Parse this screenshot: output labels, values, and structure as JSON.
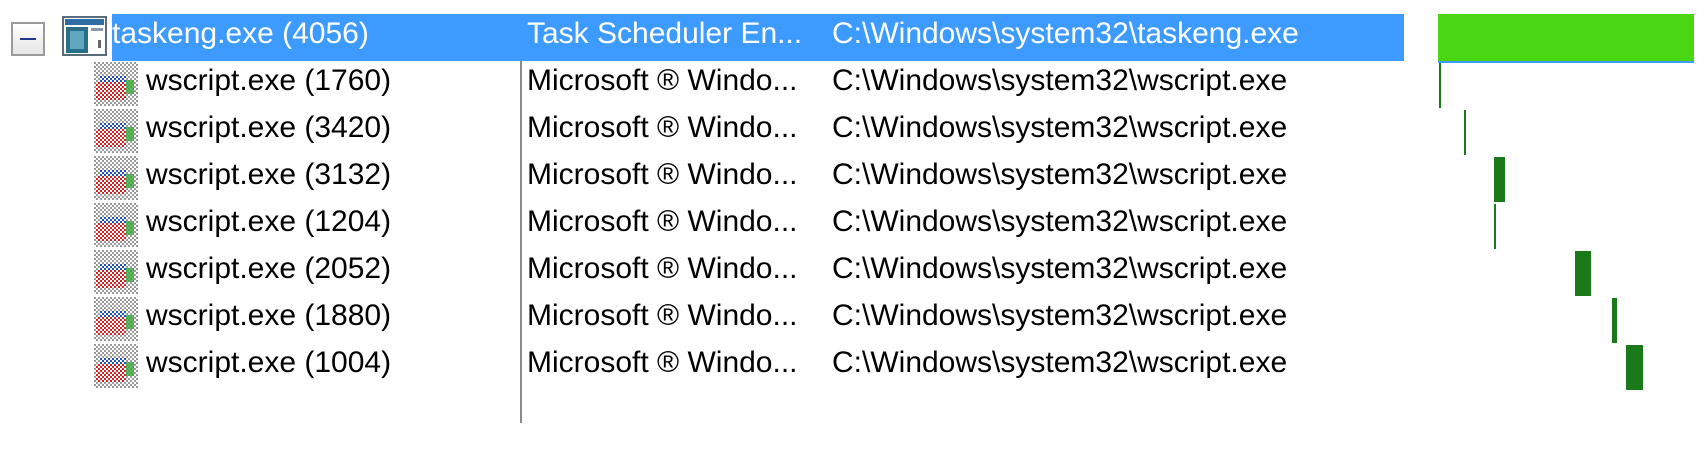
{
  "processes": [
    {
      "name": "taskeng.exe (4056)",
      "description": "Task Scheduler En...",
      "path": "C:\\Windows\\system32\\taskeng.exe",
      "timeline": {
        "start": 0.0,
        "end": 1.0
      }
    },
    {
      "name": "wscript.exe (1760)",
      "description": "Microsoft ® Windo...",
      "path": "C:\\Windows\\system32\\wscript.exe",
      "timeline": {
        "start": 0.003,
        "end": 0.013
      }
    },
    {
      "name": "wscript.exe (3420)",
      "description": "Microsoft ® Windo...",
      "path": "C:\\Windows\\system32\\wscript.exe",
      "timeline": {
        "start": 0.1,
        "end": 0.11
      }
    },
    {
      "name": "wscript.exe (3132)",
      "description": "Microsoft ® Windo...",
      "path": "C:\\Windows\\system32\\wscript.exe",
      "timeline": {
        "start": 0.22,
        "end": 0.262
      }
    },
    {
      "name": "wscript.exe (1204)",
      "description": "Microsoft ® Windo...",
      "path": "C:\\Windows\\system32\\wscript.exe",
      "timeline": {
        "start": 0.219,
        "end": 0.226
      }
    },
    {
      "name": "wscript.exe (2052)",
      "description": "Microsoft ® Windo...",
      "path": "C:\\Windows\\system32\\wscript.exe",
      "timeline": {
        "start": 0.535,
        "end": 0.598
      }
    },
    {
      "name": "wscript.exe (1880)",
      "description": "Microsoft ® Windo...",
      "path": "C:\\Windows\\system32\\wscript.exe",
      "timeline": {
        "start": 0.68,
        "end": 0.7
      }
    },
    {
      "name": "wscript.exe (1004)",
      "description": "Microsoft ® Windo...",
      "path": "C:\\Windows\\system32\\wscript.exe",
      "timeline": {
        "start": 0.735,
        "end": 0.8
      }
    }
  ],
  "icons": {
    "root": "window-icon",
    "child": "script-icon"
  },
  "colors": {
    "selection": "#3d9bff",
    "root_bar": "#4ad613",
    "child_bar": "#1a7a1a"
  }
}
